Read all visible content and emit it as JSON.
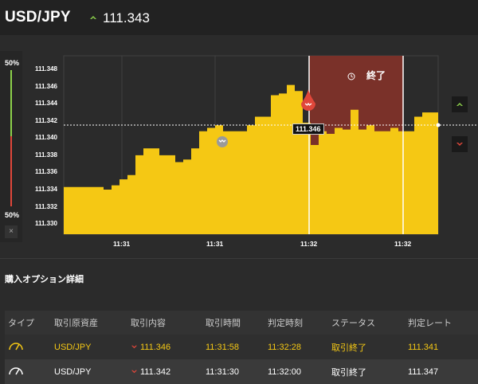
{
  "header": {
    "pair": "USD/JPY",
    "price": "111.343"
  },
  "colors": {
    "accent_yellow": "#f5c814",
    "up_green": "#8bd04a",
    "down_red": "#e0473a",
    "expired_zone": "#7a3129"
  },
  "meter": {
    "top_pct": "50%",
    "bottom_pct": "50%",
    "close_label": "×"
  },
  "chart": {
    "y_ticks": [
      "111.348",
      "111.346",
      "111.344",
      "111.342",
      "111.340",
      "111.338",
      "111.336",
      "111.334",
      "111.332",
      "111.330"
    ],
    "x_ticks": [
      "11:31",
      "11:31",
      "11:32",
      "11:32"
    ],
    "current_rate_label": "111.346",
    "end_label": "終了"
  },
  "chart_data": {
    "type": "area",
    "ylim": [
      111.3288,
      111.3496
    ],
    "x_tick_labels": [
      "11:31",
      "11:31",
      "11:32",
      "11:32"
    ],
    "y_tick_labels": [
      "111.348",
      "111.346",
      "111.344",
      "111.342",
      "111.340",
      "111.338",
      "111.336",
      "111.334",
      "111.332",
      "111.330"
    ],
    "series": [
      {
        "values": [
          111.3343,
          111.3343,
          111.3343,
          111.3343,
          111.3343,
          111.334,
          111.3345,
          111.3352,
          111.3357,
          111.338,
          111.3388,
          111.3388,
          111.338,
          111.338,
          111.3372,
          111.3375,
          111.3388,
          111.3408,
          111.3412,
          111.3415,
          111.3408,
          111.3408,
          111.3408,
          111.3415,
          111.3425,
          111.3425,
          111.345,
          111.3452,
          111.3462,
          111.3455,
          111.3418,
          111.3392,
          111.3408,
          111.3405,
          111.3412,
          111.341,
          111.3433,
          111.341,
          111.3415,
          111.3408,
          111.3408,
          111.3412,
          111.3408,
          111.3408,
          111.3425,
          111.343,
          111.343
        ]
      }
    ]
  },
  "section": {
    "title": "購入オプション詳細"
  },
  "table": {
    "headers": [
      "タイプ",
      "取引原資産",
      "取引内容",
      "取引時間",
      "判定時刻",
      "ステータス",
      "判定レート"
    ],
    "rows": [
      {
        "pair": "USD/JPY",
        "rate": "111.346",
        "time": "11:31:58",
        "judge": "11:32:28",
        "status": "取引終了",
        "judge_rate": "111.341"
      },
      {
        "pair": "USD/JPY",
        "rate": "111.342",
        "time": "11:31:30",
        "judge": "11:32:00",
        "status": "取引終了",
        "judge_rate": "111.347"
      }
    ]
  }
}
